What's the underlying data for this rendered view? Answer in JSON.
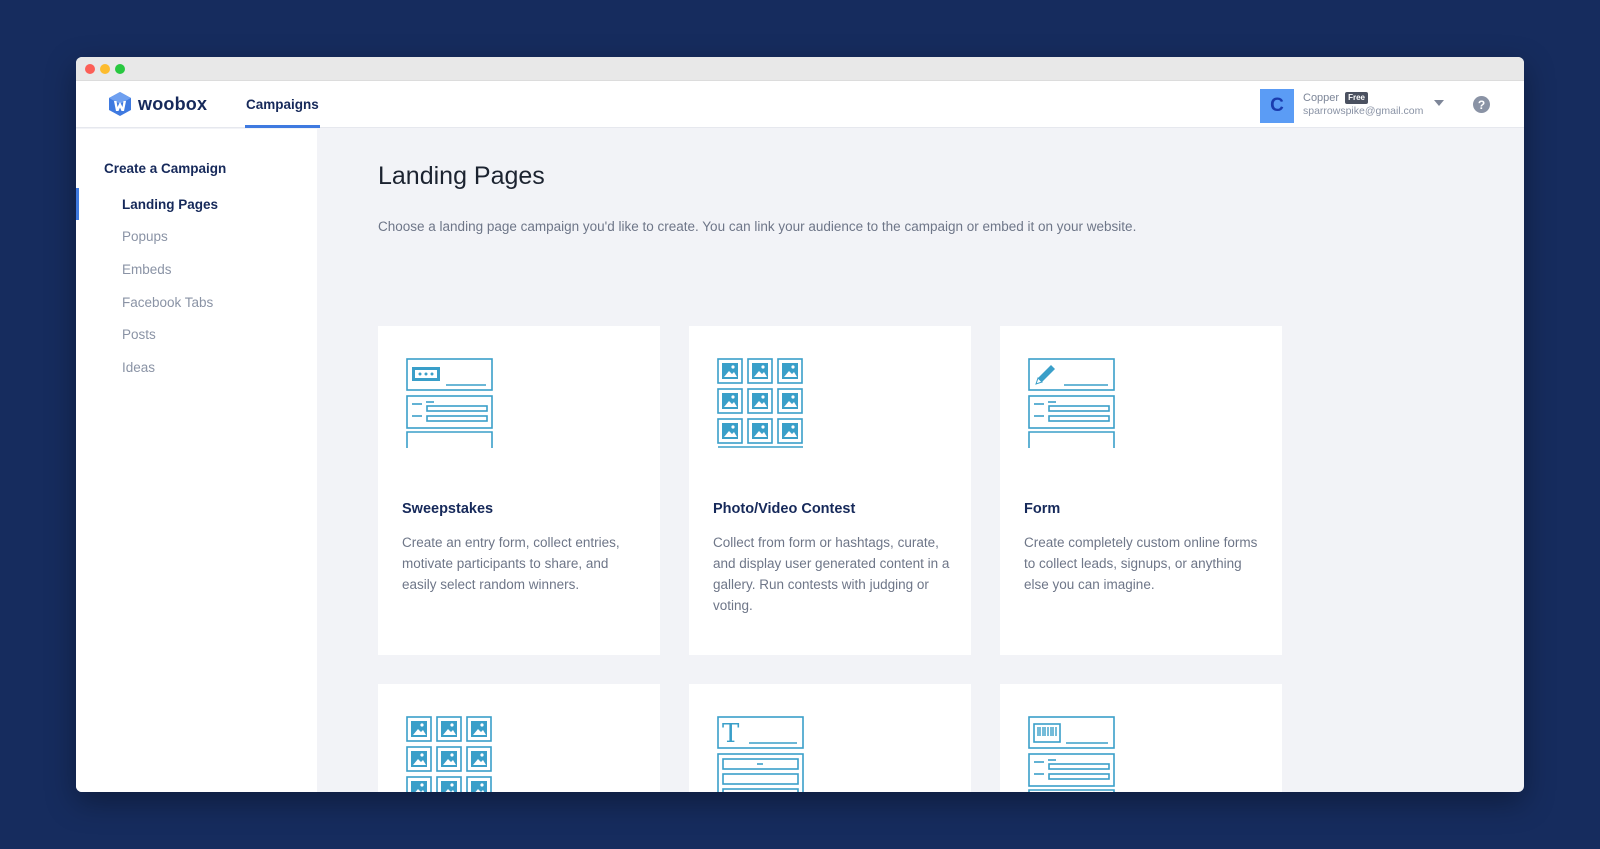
{
  "app": {
    "logo_text": "woobox"
  },
  "header": {
    "nav_tab": "Campaigns",
    "account": {
      "avatar_letter": "C",
      "name": "Copper",
      "plan_badge": "Free",
      "email": "sparrowspike@gmail.com"
    },
    "help_label": "?"
  },
  "sidebar": {
    "heading": "Create a Campaign",
    "items": [
      {
        "label": "Landing Pages",
        "active": true
      },
      {
        "label": "Popups",
        "active": false
      },
      {
        "label": "Embeds",
        "active": false
      },
      {
        "label": "Facebook Tabs",
        "active": false
      },
      {
        "label": "Posts",
        "active": false
      },
      {
        "label": "Ideas",
        "active": false
      }
    ]
  },
  "main": {
    "title": "Landing Pages",
    "description": "Choose a landing page campaign you'd like to create. You can link your audience to the campaign or embed it on your website.",
    "cards": [
      {
        "icon": "ticket-form-icon",
        "title": "Sweepstakes",
        "description": "Create an entry form, collect entries, motivate participants to share, and easily select random winners."
      },
      {
        "icon": "photo-grid-icon",
        "title": "Photo/Video Contest",
        "description": "Collect from form or hashtags, curate, and display user generated content in a gallery. Run contests with judging or voting."
      },
      {
        "icon": "pencil-form-icon",
        "title": "Form",
        "description": "Create completely custom online forms to collect leads, signups, or anything else you can imagine."
      },
      {
        "icon": "photo-grid-icon",
        "title": "",
        "description": ""
      },
      {
        "icon": "text-form-icon",
        "title": "",
        "description": ""
      },
      {
        "icon": "barcode-form-icon",
        "title": "",
        "description": ""
      }
    ]
  },
  "colors": {
    "background": "#162c5e",
    "accent": "#3f7ae0",
    "icon_stroke": "#3a9fc9",
    "heading_text": "#16295a",
    "muted_text": "#8a93a5"
  }
}
